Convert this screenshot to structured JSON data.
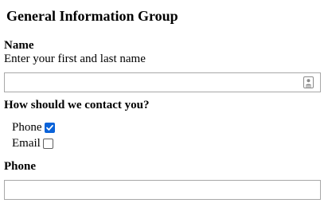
{
  "group": {
    "title": "General Information Group"
  },
  "name_field": {
    "label": "Name",
    "hint": "Enter your first and last name",
    "value": "",
    "icon": "contact-card-icon"
  },
  "contact_method": {
    "question": "How should we contact you?",
    "options": [
      {
        "label": "Phone",
        "checked": true
      },
      {
        "label": "Email",
        "checked": false
      }
    ]
  },
  "phone_field": {
    "label": "Phone",
    "value": ""
  },
  "colors": {
    "checkbox_accent": "#0b63d9",
    "input_border": "#a8a8a8"
  }
}
